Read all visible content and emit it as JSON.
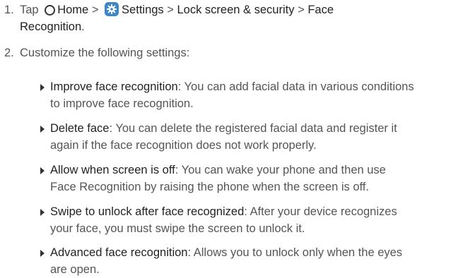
{
  "step1": {
    "number": "1.",
    "tap": "Tap",
    "home": "Home",
    "sep": ">",
    "settings": "Settings",
    "lock": "Lock screen & security",
    "face_line1": "Face",
    "face_line2": "Recognition",
    "end": "."
  },
  "step2": {
    "number": "2.",
    "text": "Customize the following settings:"
  },
  "bullets": [
    {
      "term": "Improve face recognition",
      "line1": ": You can add facial data in various conditions",
      "line2": "to improve face recognition."
    },
    {
      "term": "Delete face",
      "line1": ": You can delete the registered facial data and register it",
      "line2": "again if the face recognition does not work properly."
    },
    {
      "term": "Allow when screen is off",
      "line1": ": You can wake your phone and then use",
      "line2": "Face Recognition by raising the phone when the screen is off."
    },
    {
      "term": "Swipe to unlock after face recognized",
      "line1": ": After your device recognizes",
      "line2": "your face, you must swipe the screen to unlock it."
    },
    {
      "term": "Advanced face recognition",
      "line1": ": Allows you to unlock only when the eyes",
      "line2": "are open."
    }
  ],
  "icons": {
    "home": "home-icon",
    "settings": "settings-icon"
  }
}
